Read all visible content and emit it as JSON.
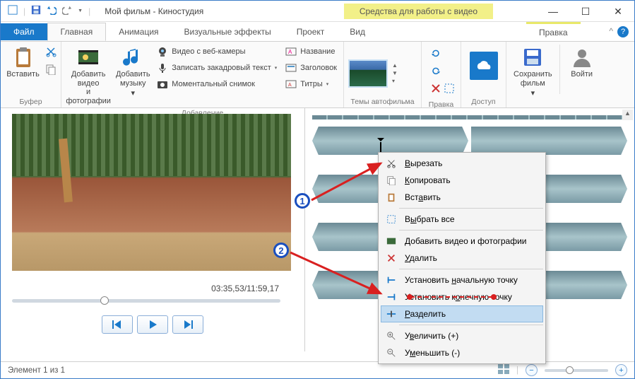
{
  "title": "Мой фильм - Киностудия",
  "videotools": "Средства для работы с видео",
  "tabs": {
    "file": "Файл",
    "home": "Главная",
    "animation": "Анимация",
    "effects": "Визуальные эффекты",
    "project": "Проект",
    "view": "Вид",
    "edit": "Правка"
  },
  "ribbon": {
    "paste": "Вставить",
    "buffer": "Буфер",
    "addvideo": "Добавить видео\nи фотографии",
    "addmusic": "Добавить\nмузыку",
    "add_dd": "▾",
    "webcam": "Видео с веб-камеры",
    "voiceover": "Записать закадровый текст",
    "snapshot": "Моментальный снимок",
    "adding": "Добавление",
    "name": "Название",
    "header": "Заголовок",
    "captions": "Титры",
    "themes": "Темы автофильма",
    "editgrp": "Правка",
    "access": "Доступ",
    "savefilm": "Сохранить\nфильм",
    "login": "Войти"
  },
  "preview": {
    "timecode": "03:35,53/11:59,17"
  },
  "ctx": {
    "cut": "Вырезать",
    "copy": "Копировать",
    "paste": "Вставить",
    "selectall": "Выбрать все",
    "addmedia": "Добавить видео и фотографии",
    "delete": "Удалить",
    "setstart": "Установить начальную точку",
    "setend": "Установить конечную точку",
    "split": "Разделить",
    "zoomin": "Увеличить (+)",
    "zoomout": "Уменьшить (-)"
  },
  "callouts": {
    "one": "1",
    "two": "2"
  },
  "status": "Элемент 1 из 1"
}
